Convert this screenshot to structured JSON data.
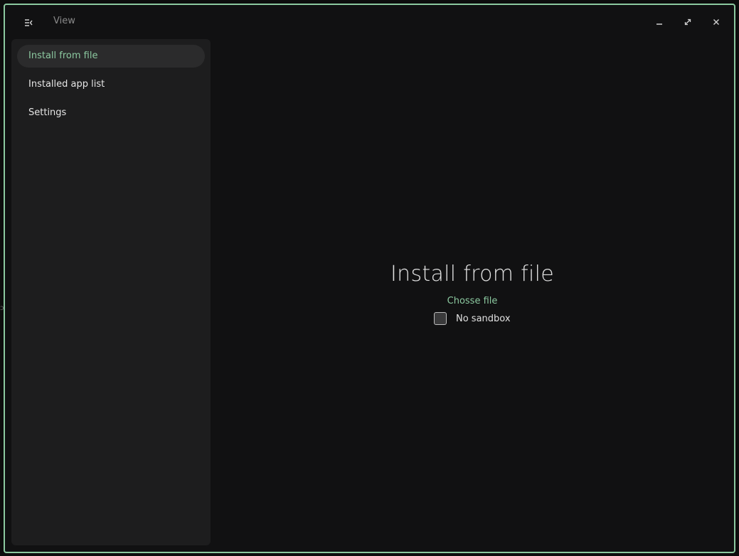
{
  "window": {
    "title": "View",
    "accent_color": "#8cc9a0"
  },
  "titlebar": {
    "menu_icon": "sidebar-toggle-icon",
    "minimize_icon": "minimize-icon",
    "maximize_icon": "maximize-icon",
    "close_icon": "close-icon"
  },
  "sidebar": {
    "items": [
      {
        "label": "Install from file",
        "active": true
      },
      {
        "label": "Installed app list",
        "active": false
      },
      {
        "label": "Settings",
        "active": false
      }
    ]
  },
  "main": {
    "title": "Install from file",
    "choose_file_label": "Chosse file",
    "no_sandbox_label": "No sandbox",
    "no_sandbox_checked": false
  }
}
